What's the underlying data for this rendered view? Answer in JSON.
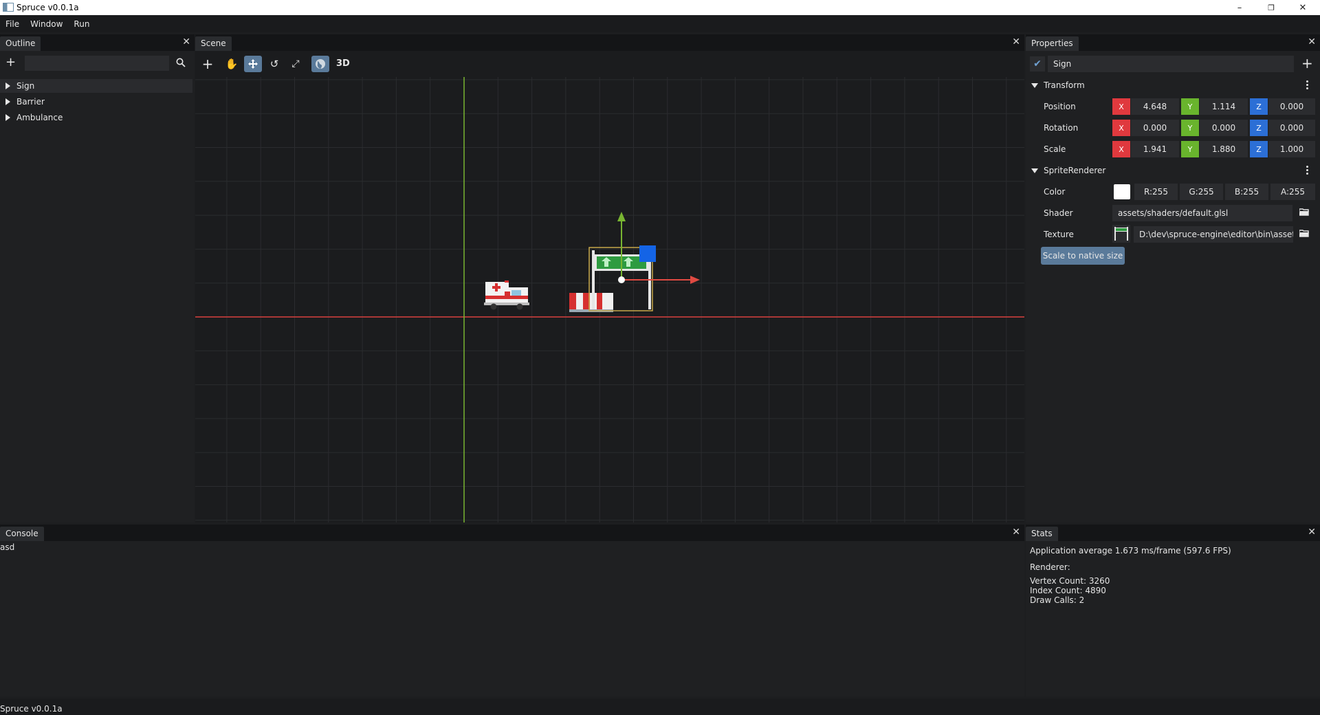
{
  "window": {
    "title": "Spruce v0.0.1a"
  },
  "menu": [
    "File",
    "Window",
    "Run"
  ],
  "outline": {
    "tab": "Outline",
    "search_placeholder": "",
    "items": [
      "Sign",
      "Barrier",
      "Ambulance"
    ]
  },
  "scene": {
    "tab": "Scene",
    "mode_label": "3D",
    "colors": {
      "x_axis": "#d9403f",
      "y_axis": "#79b531",
      "gizmo_z": "#1464e6"
    }
  },
  "properties": {
    "tab": "Properties",
    "entity_name": "Sign",
    "transform": {
      "header": "Transform",
      "rows": [
        {
          "label": "Position",
          "x": "4.648",
          "y": "1.114",
          "z": "0.000"
        },
        {
          "label": "Rotation",
          "x": "0.000",
          "y": "0.000",
          "z": "0.000"
        },
        {
          "label": "Scale",
          "x": "1.941",
          "y": "1.880",
          "z": "1.000"
        }
      ],
      "axis_labels": [
        "X",
        "Y",
        "Z"
      ]
    },
    "sprite": {
      "header": "SpriteRenderer",
      "color_label": "Color",
      "r": "R:255",
      "g": "G:255",
      "b": "B:255",
      "a": "A:255",
      "shader_label": "Shader",
      "shader_value": "assets/shaders/default.glsl",
      "texture_label": "Texture",
      "texture_value": "D:\\dev\\spruce-engine\\editor\\bin\\assets",
      "scale_button": "Scale to native size"
    }
  },
  "console": {
    "tab": "Console",
    "lines": [
      "asd"
    ]
  },
  "stats": {
    "tab": "Stats",
    "avg": "Application average 1.673 ms/frame (597.6 FPS)",
    "renderer": "Renderer:",
    "vertex": "Vertex Count: 3260",
    "index": "Index Count: 4890",
    "draws": "Draw Calls: 2"
  },
  "status": "Spruce v0.0.1a"
}
